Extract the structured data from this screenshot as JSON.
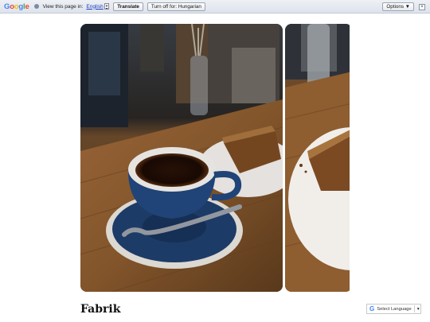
{
  "translate_bar": {
    "logo": [
      "G",
      "o",
      "o",
      "g",
      "l",
      "e"
    ],
    "prompt": "View this page in:",
    "language": "English",
    "translate_label": "Translate",
    "turn_off_label": "Turn off for: Hungarian",
    "options_label": "Options ▼",
    "close_label": "×"
  },
  "gallery": {
    "images": [
      "coffee-and-cake-photo",
      "cake-plate-photo"
    ]
  },
  "page": {
    "title": "Fabrik"
  },
  "language_widget": {
    "label": "Select Language",
    "dropdown_arrow": "▼"
  },
  "colors": {
    "google_blue": "#4285f4",
    "link_blue": "#1a3ec0"
  }
}
